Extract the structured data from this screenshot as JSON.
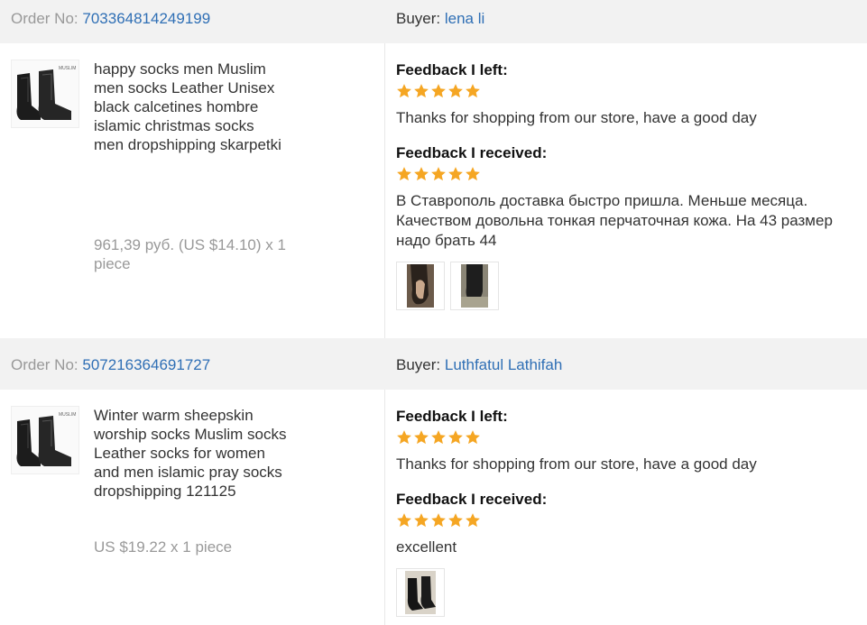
{
  "orders": [
    {
      "order_no_label": "Order No:",
      "order_no": "703364814249199",
      "buyer_label": "Buyer:",
      "buyer_name": "lena li",
      "product_name": "happy socks men Muslim men socks Leather Unisex black calcetines hombre islamic christmas socks men dropshipping skarpetki",
      "price": "961,39 руб. (US $14.10) x 1 piece",
      "feedback_left_label": "Feedback I left:",
      "feedback_left_rating": 5,
      "feedback_left_text": "Thanks for shopping from our store, have a good day",
      "feedback_received_label": "Feedback I received:",
      "feedback_received_rating": 5,
      "feedback_received_text": "В Ставрополь доставка быстро пришла. Меньше месяца. Качеством довольна тонкая перчаточная кожа. На 43 размер надо брать 44",
      "photo_count": 2
    },
    {
      "order_no_label": "Order No:",
      "order_no": "507216364691727",
      "buyer_label": "Buyer:",
      "buyer_name": "Luthfatul Lathifah",
      "product_name": "Winter warm sheepskin worship socks Muslim socks Leather socks for women and men islamic pray socks dropshipping 121125",
      "price": "US $19.22 x 1 piece",
      "feedback_left_label": "Feedback I left:",
      "feedback_left_rating": 5,
      "feedback_left_text": "Thanks for shopping from our store, have a good day",
      "feedback_received_label": "Feedback I received:",
      "feedback_received_rating": 5,
      "feedback_received_text": "excellent",
      "photo_count": 1
    }
  ],
  "colors": {
    "link": "#2f6fb5",
    "star": "#f5a623",
    "header_bg": "#f2f2f2"
  }
}
